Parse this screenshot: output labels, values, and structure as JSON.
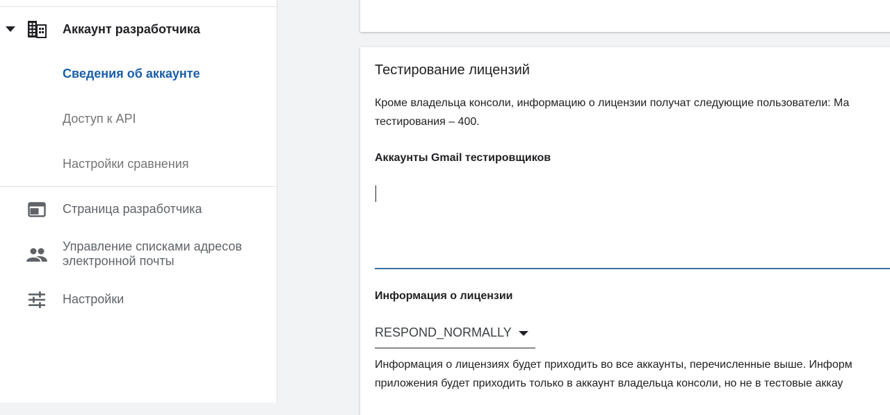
{
  "sidebar": {
    "developer_account": {
      "label": "Аккаунт разработчика",
      "icon": "building-icon"
    },
    "sub_items": [
      {
        "label": "Сведения об аккаунте",
        "active": true
      },
      {
        "label": "Доступ к API",
        "active": false
      },
      {
        "label": "Настройки сравнения",
        "active": false
      }
    ],
    "items": [
      {
        "label": "Страница разработчика",
        "icon": "web-page-icon"
      },
      {
        "label_line1": "Управление списками адресов",
        "label_line2": "электронной почты",
        "icon": "people-icon"
      },
      {
        "label": "Настройки",
        "icon": "tune-icon"
      }
    ]
  },
  "license_testing": {
    "title": "Тестирование лицензий",
    "description_line1": "Кроме владельца консоли, информацию о лицензии получат следующие пользователи: Ма",
    "description_line2": "тестирования – 400.",
    "testers_label": "Аккаунты Gmail тестировщиков",
    "testers_value": "",
    "license_info_label": "Информация о лицензии",
    "license_response_selected": "RESPOND_NORMALLY",
    "license_note_line1": "Информация о лицензиях будет приходить во все аккаунты, перечисленные выше. Информ",
    "license_note_line2": "приложения будет приходить только в аккаунт владельца консоли, но не в тестовые аккау"
  },
  "colors": {
    "active_link": "#1a5fa8",
    "input_underline": "#3a6f9e",
    "background": "#f1f3f4"
  }
}
